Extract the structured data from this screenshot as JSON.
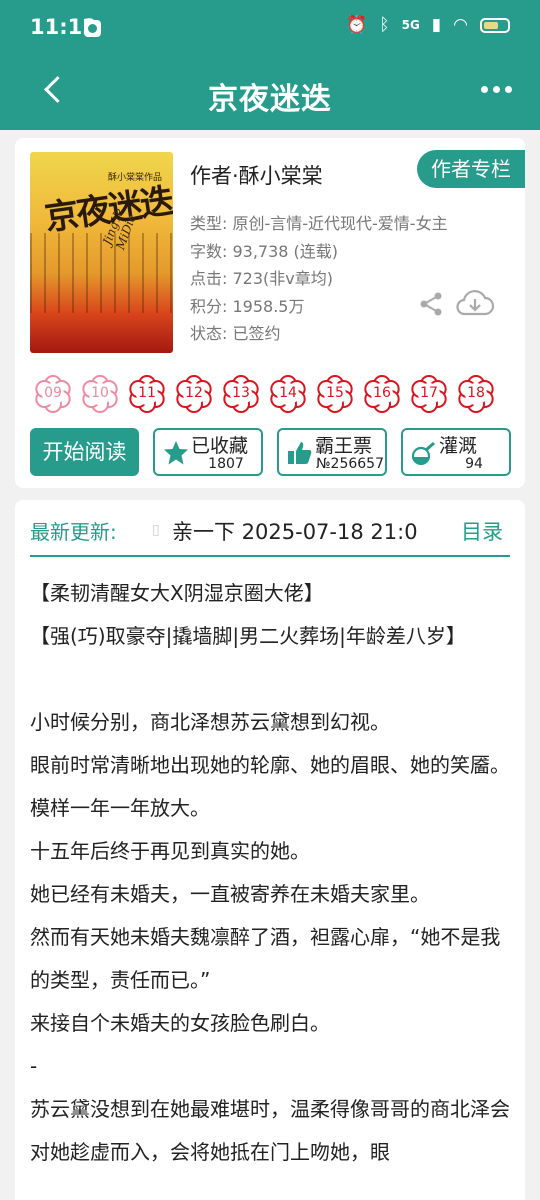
{
  "status_bar": {
    "time": "11:12",
    "signal": "5G"
  },
  "header": {
    "title": "京夜迷迭"
  },
  "book": {
    "author_line": "作者·酥小棠棠",
    "author_column_label": "作者专栏",
    "cover": {
      "title_art": "京夜迷迭",
      "author_small": "酥小棠棠作品",
      "romanized": "JingYe MiDie"
    },
    "meta": [
      "类型: 原创-言情-近代现代-爱情-女主",
      "字数: 93,738 (连载)",
      "点击: 723(非v章均)",
      "积分: 1958.5万",
      "状态: 已签约"
    ],
    "badges": [
      "09",
      "10",
      "11",
      "12",
      "13",
      "14",
      "15",
      "16",
      "17",
      "18"
    ],
    "badge_colors": {
      "inactive": "#f08aa0",
      "active": "#d9141e"
    }
  },
  "actions": {
    "read_label": "开始阅读",
    "collect": {
      "label": "已收藏",
      "count": "1807",
      "icon": "star-icon"
    },
    "bawang": {
      "label": "霸王票",
      "count": "№256657",
      "icon": "thumbs-up-icon"
    },
    "irrigate": {
      "label": "灌溉",
      "count": "94",
      "icon": "flask-icon"
    }
  },
  "latest": {
    "label": "最新更新:",
    "text": "亲一下  2025-07-18 21:0",
    "catalog_label": "目录"
  },
  "description": [
    "【柔韧清醒女大X阴湿京圈大佬】",
    "【强(巧)取豪夺|撬墙脚|男二火葬场|年龄差八岁】",
    "",
    "小时候分别，商北泽想苏云黛想到幻视。",
    "眼前时常清晰地出现她的轮廓、她的眉眼、她的笑靥。",
    "模样一年一年放大。",
    "十五年后终于再见到真实的她。",
    "她已经有未婚夫，一直被寄养在未婚夫家里。",
    "然而有天她未婚夫魏凛醉了酒，袒露心扉，“她不是我的类型，责任而已。”",
    "来接自个未婚夫的女孩脸色刷白。",
    "-",
    "苏云黛没想到在她最难堪时，温柔得像哥哥的商北泽会对她趁虚而入，会将她抵在门上吻她，眼"
  ],
  "colors": {
    "accent": "#279c8c"
  }
}
